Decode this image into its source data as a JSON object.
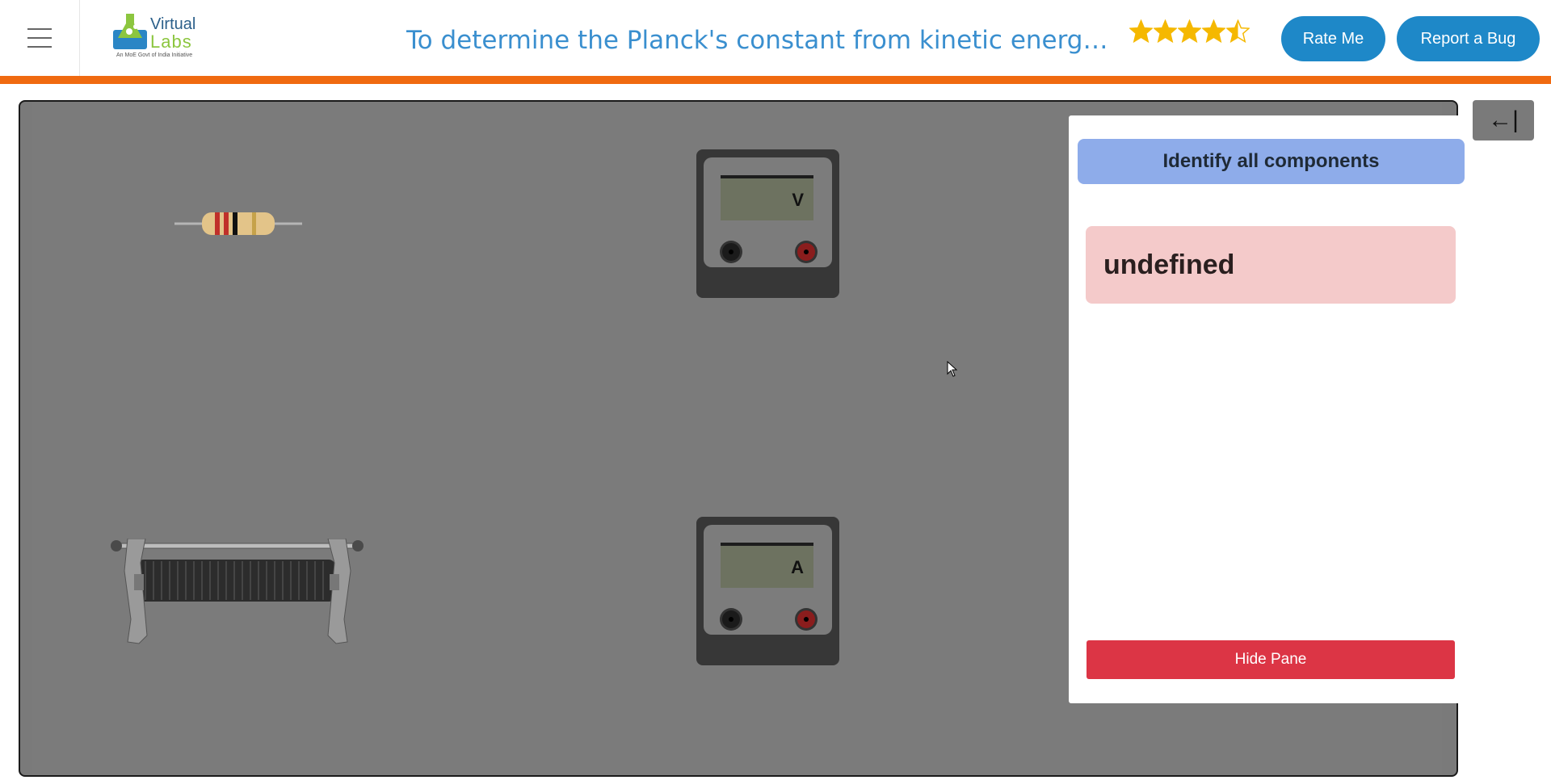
{
  "header": {
    "menu_icon": "hamburger-icon",
    "logo": {
      "line1": "Virtual",
      "line2": "Labs",
      "tagline": "An MoE Govt of India Initiative"
    },
    "title": "To determine the Planck's constant from kinetic energy versus frequency graph",
    "rating": {
      "value": 4.5,
      "max": 5
    },
    "rate_label": "Rate Me",
    "bug_label": "Report a Bug"
  },
  "colors": {
    "accent_bar": "#f06a10",
    "button": "#1e88c8",
    "pane_header": "#8eacea",
    "message_bg": "#f4caca",
    "hide_button": "#dc3545"
  },
  "workspace": {
    "collapse_icon": "←|",
    "components": [
      {
        "name": "resistor"
      },
      {
        "name": "voltmeter",
        "label": "V"
      },
      {
        "name": "rheostat"
      },
      {
        "name": "ammeter",
        "label": "A"
      }
    ]
  },
  "pane": {
    "header": "Identify all components",
    "message": "undefined",
    "hide_label": "Hide Pane"
  }
}
